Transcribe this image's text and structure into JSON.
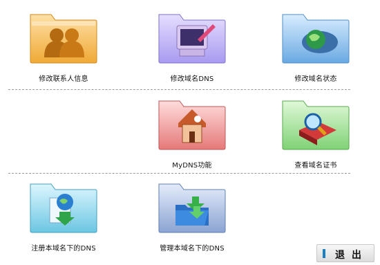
{
  "tiles": {
    "modify_contact": "修改联系人信息",
    "modify_dns": "修改域名DNS",
    "modify_status": "修改域名状态",
    "mydns": "MyDNS功能",
    "view_certificate": "查看域名证书",
    "register_dns": "注册本域名下的DNS",
    "manage_dns": "管理本域名下的DNS"
  },
  "icons": {
    "modify_contact": "people-icon",
    "modify_dns": "computer-pen-icon",
    "modify_status": "globe-disc-icon",
    "mydns": "house-icon",
    "view_certificate": "book-magnifier-icon",
    "register_dns": "globe-download-icon",
    "manage_dns": "folder-download-icon"
  },
  "folder_colors": {
    "orange": "#f2b54c",
    "purple": "#b9aaf0",
    "blue": "#7fb9ea",
    "red": "#ec8f8f",
    "green": "#94df8a",
    "cyan": "#7ed1ea",
    "steel": "#8ea7d6"
  },
  "exit_button": {
    "label": "退出"
  }
}
